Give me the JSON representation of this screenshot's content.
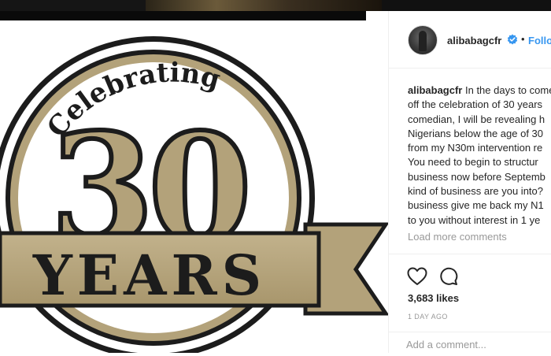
{
  "post": {
    "username": "alibabagcfr",
    "follow_label": "Follow",
    "caption_lines": [
      "In the days to come",
      "off the celebration of 30 years",
      "comedian, I will be revealing h",
      "Nigerians below the age of 30",
      "from my N30m intervention re",
      "You need to begin to structur",
      "business now before Septemb",
      "kind of business are you into?",
      "business give me back my N1",
      "to you without interest in 1 ye"
    ],
    "load_more": "Load more comments",
    "likes": "3,683 likes",
    "time": "1 DAY AGO",
    "comment_placeholder": "Add a comment..."
  },
  "image": {
    "arc_text": "Celebrating",
    "number": "30",
    "banner_text": "YEARS"
  },
  "colors": {
    "gold": "#b3a27a",
    "dark": "#1c1c1c",
    "link": "#3897f0",
    "muted": "#999999"
  },
  "icons": [
    "heart-icon",
    "comment-icon",
    "verified-badge-icon"
  ]
}
